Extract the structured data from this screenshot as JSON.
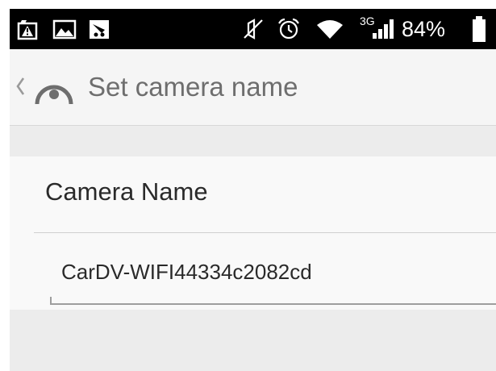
{
  "status_bar": {
    "icons": [
      "warning-notification-icon",
      "image-notification-icon",
      "app-notification-icon",
      "mute-icon",
      "alarm-icon",
      "wifi-icon",
      "signal-icon",
      "battery-icon"
    ],
    "network_type": "3G",
    "battery_percent": "84%",
    "battery_level": 0.84
  },
  "action_bar": {
    "title": "Set camera name",
    "icons": [
      "back-chevron-icon",
      "app-logo-icon"
    ]
  },
  "section": {
    "header": "Camera Name"
  },
  "camera_name_field": {
    "value": "CarDV-WIFI44334c2082cd"
  },
  "colors": {
    "status_bar_bg": "#000000",
    "action_bar_bg": "#f5f5f5",
    "title_text": "#6e6e6e",
    "card_bg": "#f9f9f9",
    "band_bg": "#ececec"
  }
}
